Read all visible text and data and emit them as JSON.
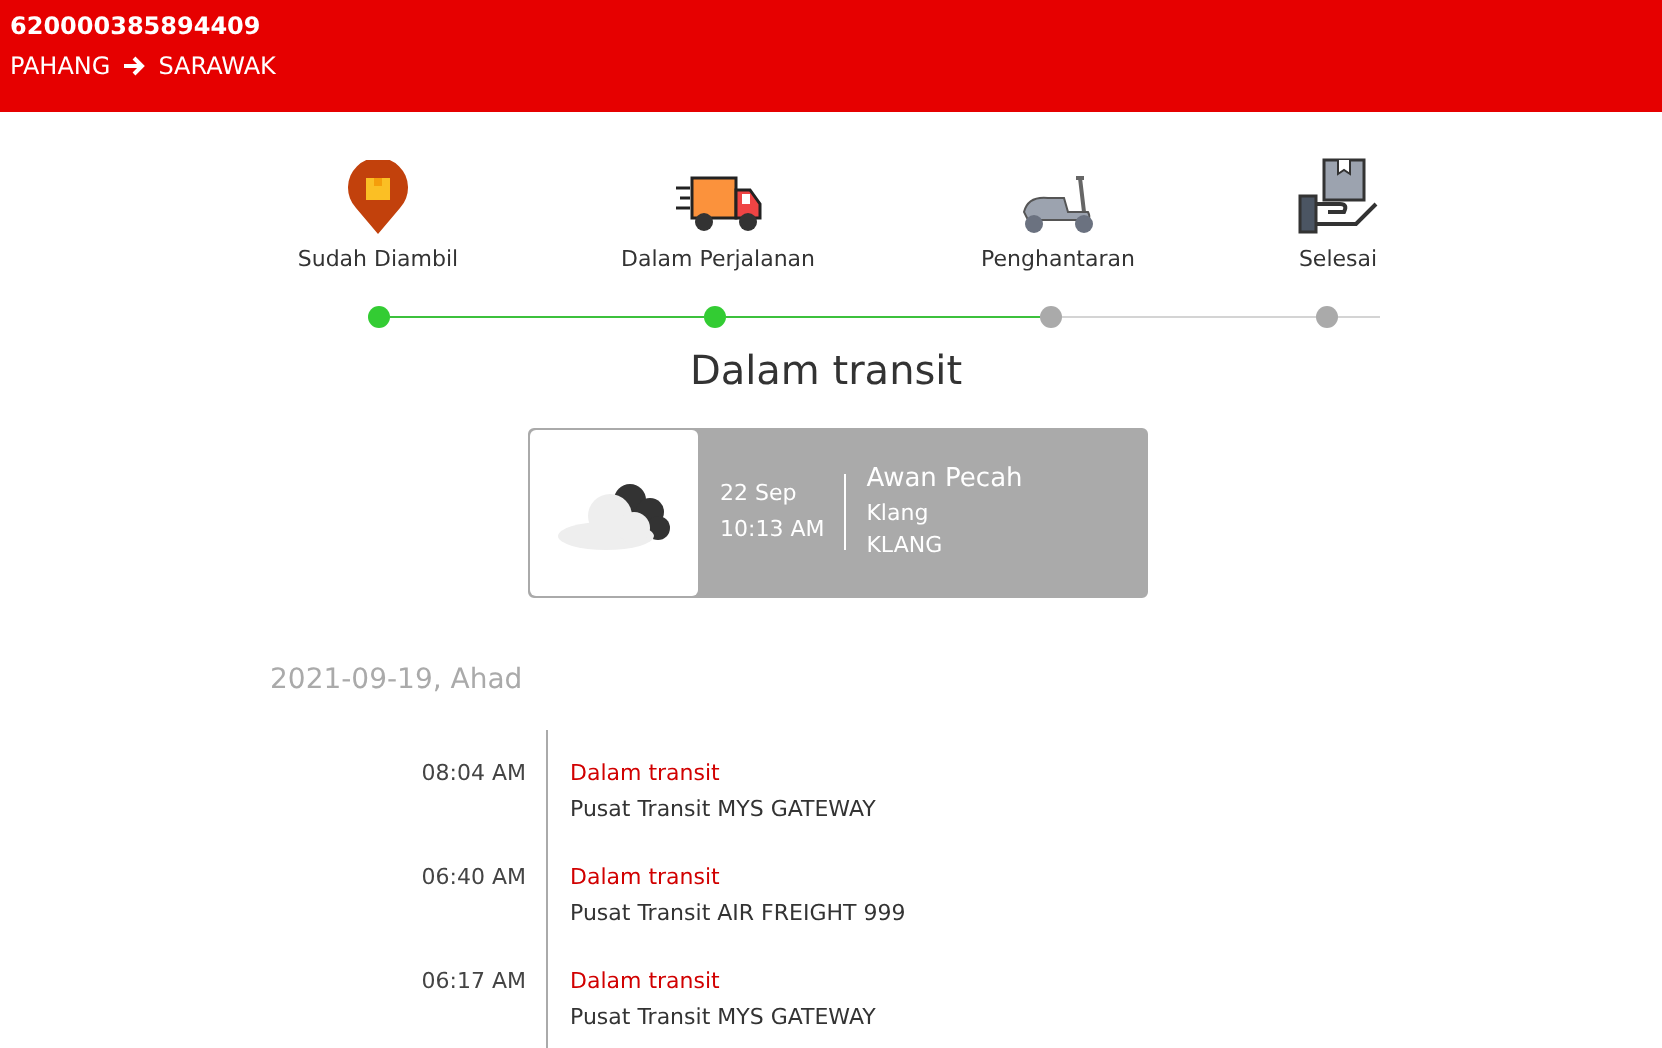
{
  "header": {
    "tracking_number": "620000385894409",
    "origin": "PAHANG",
    "destination": "SARAWAK"
  },
  "steps": [
    {
      "kind": "pickup",
      "label": "Sudah Diambil",
      "reached": true
    },
    {
      "kind": "truck",
      "label": "Dalam Perjalanan",
      "reached": true
    },
    {
      "kind": "scooter",
      "label": "Penghantaran",
      "reached": false
    },
    {
      "kind": "handover",
      "label": "Selesai",
      "reached": false
    }
  ],
  "status_title": "Dalam transit",
  "latest": {
    "date": "22 Sep",
    "time": "10:13 AM",
    "weather": "Awan Pecah",
    "city": "Klang",
    "area": "KLANG"
  },
  "history": {
    "date": "2021-09-19, Ahad",
    "events": [
      {
        "time": "08:04 AM",
        "status": "Dalam transit",
        "location": "Pusat Transit MYS GATEWAY"
      },
      {
        "time": "06:40 AM",
        "status": "Dalam transit",
        "location": "Pusat Transit AIR FREIGHT 999"
      },
      {
        "time": "06:17 AM",
        "status": "Dalam transit",
        "location": "Pusat Transit MYS GATEWAY"
      }
    ]
  }
}
